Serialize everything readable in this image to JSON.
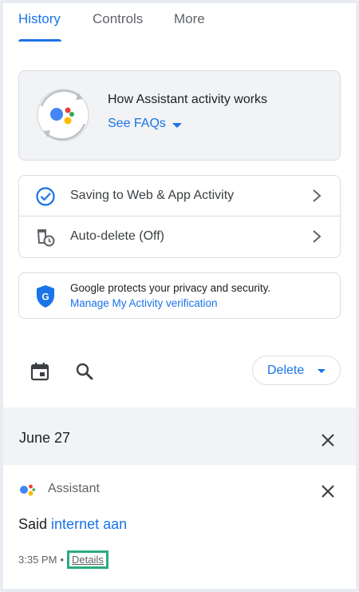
{
  "tabs": [
    {
      "label": "History",
      "active": true
    },
    {
      "label": "Controls",
      "active": false
    },
    {
      "label": "More",
      "active": false
    }
  ],
  "faq_card": {
    "title": "How Assistant activity works",
    "link": "See FAQs"
  },
  "settings": [
    {
      "label": "Saving to Web & App Activity",
      "icon": "check-circle-icon"
    },
    {
      "label": "Auto-delete (Off)",
      "icon": "auto-delete-icon"
    }
  ],
  "privacy": {
    "text": "Google protects your privacy and security.",
    "link": "Manage My Activity verification"
  },
  "toolbar": {
    "delete_label": "Delete"
  },
  "date_group": {
    "label": "June 27"
  },
  "activity": {
    "source": "Assistant",
    "said_prefix": "Said",
    "query": "internet aan",
    "time": "3:35 PM",
    "separator": "•",
    "details": "Details"
  },
  "colors": {
    "accent": "#1a73e8",
    "highlight_box": "#2bab7b",
    "section_bg": "#f1f3f4"
  }
}
